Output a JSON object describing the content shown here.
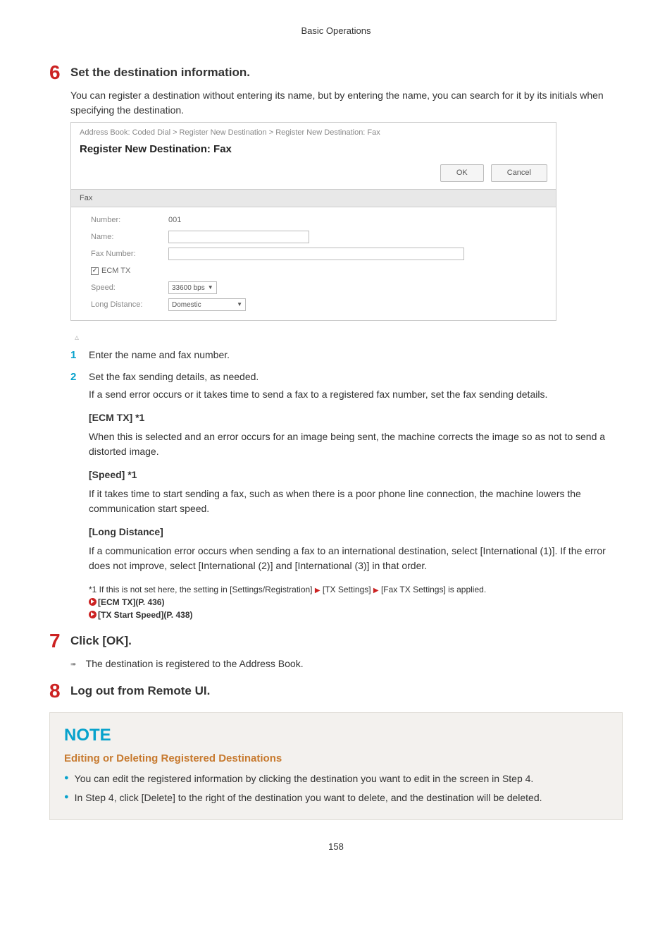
{
  "header": "Basic Operations",
  "step6": {
    "num": "6",
    "title": "Set the destination information.",
    "intro": "You can register a destination without entering its name, but by entering the name, you can search for it by its initials when specifying the destination."
  },
  "screenshot": {
    "breadcrumb": "Address Book: Coded Dial > Register New Destination > Register New Destination: Fax",
    "title": "Register New Destination: Fax",
    "ok": "OK",
    "cancel": "Cancel",
    "section": "Fax",
    "number_label": "Number:",
    "number_value": "001",
    "name_label": "Name:",
    "faxnum_label": "Fax Number:",
    "ecm_label": "ECM TX",
    "speed_label": "Speed:",
    "speed_value": "33600 bps",
    "ld_label": "Long Distance:",
    "ld_value": "Domestic",
    "check": "✓"
  },
  "substep1": {
    "num": "1",
    "text": "Enter the name and fax number."
  },
  "substep2": {
    "num": "2",
    "line1": "Set the fax sending details, as needed.",
    "line2": "If a send error occurs or it takes time to send a fax to a registered fax number, set the fax sending details."
  },
  "ecm": {
    "title": "[ECM TX] *1",
    "body": "When this is selected and an error occurs for an image being sent, the machine corrects the image so as not to send a distorted image."
  },
  "speed": {
    "title": "[Speed] *1",
    "body": "If it takes time to start sending a fax, such as when there is a poor phone line connection, the machine lowers the communication start speed."
  },
  "ld": {
    "title": "[Long Distance]",
    "body": "If a communication error occurs when sending a fax to an international destination, select [International (1)]. If the error does not improve, select [International (2)] and [International (3)] in that order."
  },
  "footnote": {
    "pre": "*1 If this is not set here, the setting in [Settings/Registration] ",
    "mid1": " [TX Settings] ",
    "mid2": " [Fax TX Settings] is applied.",
    "link1": "[ECM TX](P. 436)",
    "link2": "[TX Start Speed](P. 438)"
  },
  "step7": {
    "num": "7",
    "title": "Click [OK].",
    "result": "The destination is registered to the Address Book."
  },
  "step8": {
    "num": "8",
    "title": "Log out from Remote UI."
  },
  "note": {
    "heading": "NOTE",
    "sub": "Editing or Deleting Registered Destinations",
    "li1": "You can edit the registered information by clicking the destination you want to edit in the screen in Step 4.",
    "li2": "In Step 4, click [Delete] to the right of the destination you want to delete, and the destination will be deleted."
  },
  "pagenum": "158"
}
